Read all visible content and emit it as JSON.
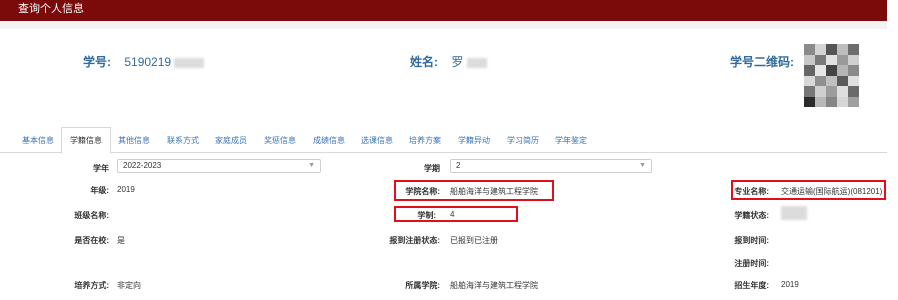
{
  "window": {
    "title": "查询个人信息"
  },
  "profile": {
    "student_id_label": "学号:",
    "student_id_value": "5190219",
    "name_label": "姓名:",
    "name_value": "罗",
    "qr_label": "学号二维码:"
  },
  "tabs": [
    {
      "label": "基本信息",
      "active": false
    },
    {
      "label": "学籍信息",
      "active": true
    },
    {
      "label": "其他信息",
      "active": false
    },
    {
      "label": "联系方式",
      "active": false
    },
    {
      "label": "家庭成员",
      "active": false
    },
    {
      "label": "奖惩信息",
      "active": false
    },
    {
      "label": "成绩信息",
      "active": false
    },
    {
      "label": "选课信息",
      "active": false
    },
    {
      "label": "培养方案",
      "active": false
    },
    {
      "label": "学籍异动",
      "active": false
    },
    {
      "label": "学习简历",
      "active": false
    },
    {
      "label": "学年鉴定",
      "active": false
    }
  ],
  "filters": {
    "year_label": "学年",
    "year_value": "2022-2023",
    "term_label": "学期",
    "term_value": "2"
  },
  "fields": {
    "grade_label": "年级:",
    "grade_value": "2019",
    "college_label": "学院名称:",
    "college_value": "船舶海洋与建筑工程学院",
    "major_label": "专业名称:",
    "major_value": "交通运输(国际航运)(081201)",
    "class_label": "班级名称:",
    "class_value": "",
    "duration_label": "学制:",
    "duration_value": "4",
    "status_label": "学籍状态:",
    "status_value": "",
    "enrolled_label": "是否在校:",
    "enrolled_value": "是",
    "reg_status_label": "报到注册状态:",
    "reg_status_value": "已报到已注册",
    "report_time_label": "报到时间:",
    "report_time_value": "",
    "reg_time_label": "注册时间:",
    "reg_time_value": "",
    "training_label": "培养方式:",
    "training_value": "非定向",
    "affiliated_label": "所属学院:",
    "affiliated_value": "船舶海洋与建筑工程学院",
    "admission_year_label": "招生年度:",
    "admission_year_value": "2019"
  },
  "colors": {
    "titlebar": "#7b0a0a",
    "highlight_box": "#e0101a",
    "link": "#3a72b5"
  }
}
